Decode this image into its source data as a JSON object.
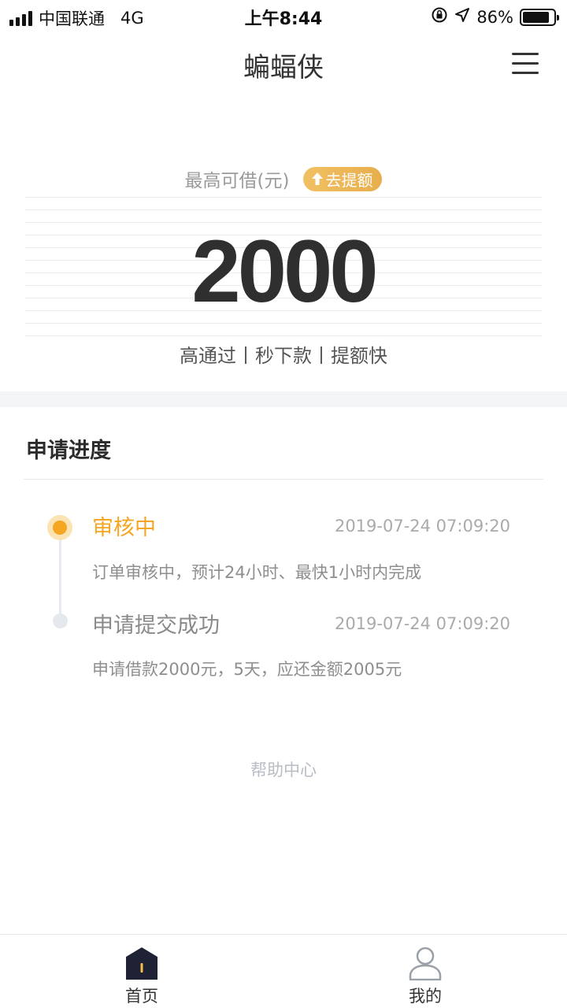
{
  "status_bar": {
    "carrier": "中国联通",
    "network": "4G",
    "time": "上午8:44",
    "battery": "86%",
    "battery_level": 0.86
  },
  "nav": {
    "title": "蝙蝠侠",
    "menu_icon": "hamburger-menu-icon"
  },
  "loan": {
    "limit_label": "最高可借(元)",
    "raise_label": "去提额",
    "raise_icon": "arrow-up-icon",
    "amount": "2000",
    "slogan": "高通过丨秒下款丨提额快"
  },
  "progress": {
    "title": "申请进度",
    "steps": [
      {
        "title": "审核中",
        "time": "2019-07-24 07:09:20",
        "desc": "订单审核中，预计24小时、最快1小时内完成",
        "active": true
      },
      {
        "title": "申请提交成功",
        "time": "2019-07-24 07:09:20",
        "desc": "申请借款2000元，5天，应还金额2005元",
        "active": false
      }
    ]
  },
  "help_link": "帮助中心",
  "tabs": [
    {
      "label": "首页",
      "icon": "home-icon",
      "selected": true
    },
    {
      "label": "我的",
      "icon": "user-icon",
      "selected": false
    }
  ],
  "colors": {
    "accent": "#f5a623",
    "badge": "#ebb255",
    "nav_dark": "#1f2235"
  }
}
